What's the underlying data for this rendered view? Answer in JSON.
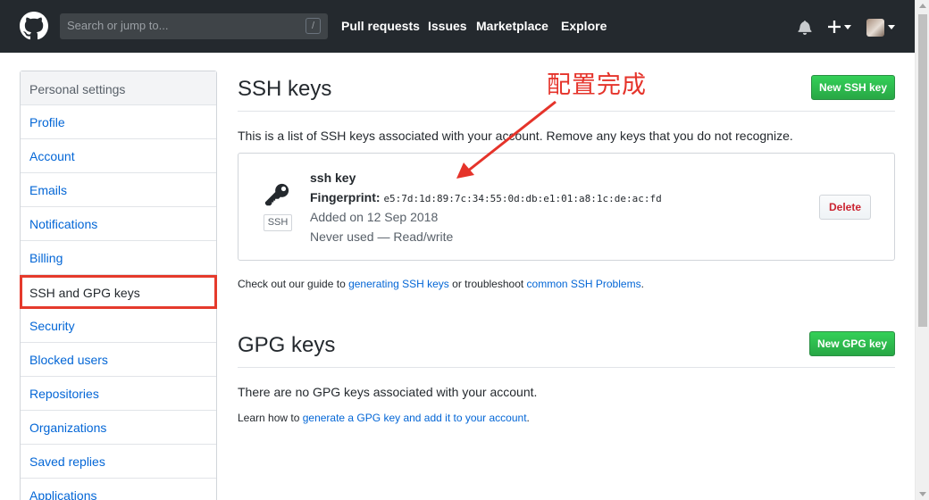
{
  "header": {
    "search_placeholder": "Search or jump to...",
    "search_shortcut": "/",
    "nav": [
      "Pull requests",
      "Issues",
      "Marketplace",
      "Explore"
    ]
  },
  "sidebar": {
    "heading": "Personal settings",
    "items": [
      {
        "label": "Profile"
      },
      {
        "label": "Account"
      },
      {
        "label": "Emails"
      },
      {
        "label": "Notifications"
      },
      {
        "label": "Billing"
      },
      {
        "label": "SSH and GPG keys",
        "selected": true
      },
      {
        "label": "Security"
      },
      {
        "label": "Blocked users"
      },
      {
        "label": "Repositories"
      },
      {
        "label": "Organizations"
      },
      {
        "label": "Saved replies"
      },
      {
        "label": "Applications"
      }
    ]
  },
  "ssh": {
    "title": "SSH keys",
    "new_button": "New SSH key",
    "description": "This is a list of SSH keys associated with your account. Remove any keys that you do not recognize.",
    "key": {
      "name": "ssh key",
      "badge": "SSH",
      "fingerprint_label": "Fingerprint:",
      "fingerprint": "e5:7d:1d:89:7c:34:55:0d:db:e1:01:a8:1c:de:ac:fd",
      "added": "Added on 12 Sep 2018",
      "usage": "Never used — Read/write",
      "delete_label": "Delete"
    },
    "guide_prefix": "Check out our guide to ",
    "guide_link": "generating SSH keys",
    "guide_middle": " or troubleshoot ",
    "guide_link2": "common SSH Problems",
    "guide_suffix": "."
  },
  "gpg": {
    "title": "GPG keys",
    "new_button": "New GPG key",
    "description": "There are no GPG keys associated with your account.",
    "learn_prefix": "Learn how to ",
    "learn_link": "generate a GPG key and add it to your account",
    "learn_suffix": "."
  },
  "annotation": {
    "text": "配置完成",
    "color": "#e5332a"
  },
  "colors": {
    "header_bg": "#24292e",
    "link": "#0366d6",
    "green": "#28a745",
    "danger": "#cb2431",
    "highlight": "#e53a2c"
  }
}
